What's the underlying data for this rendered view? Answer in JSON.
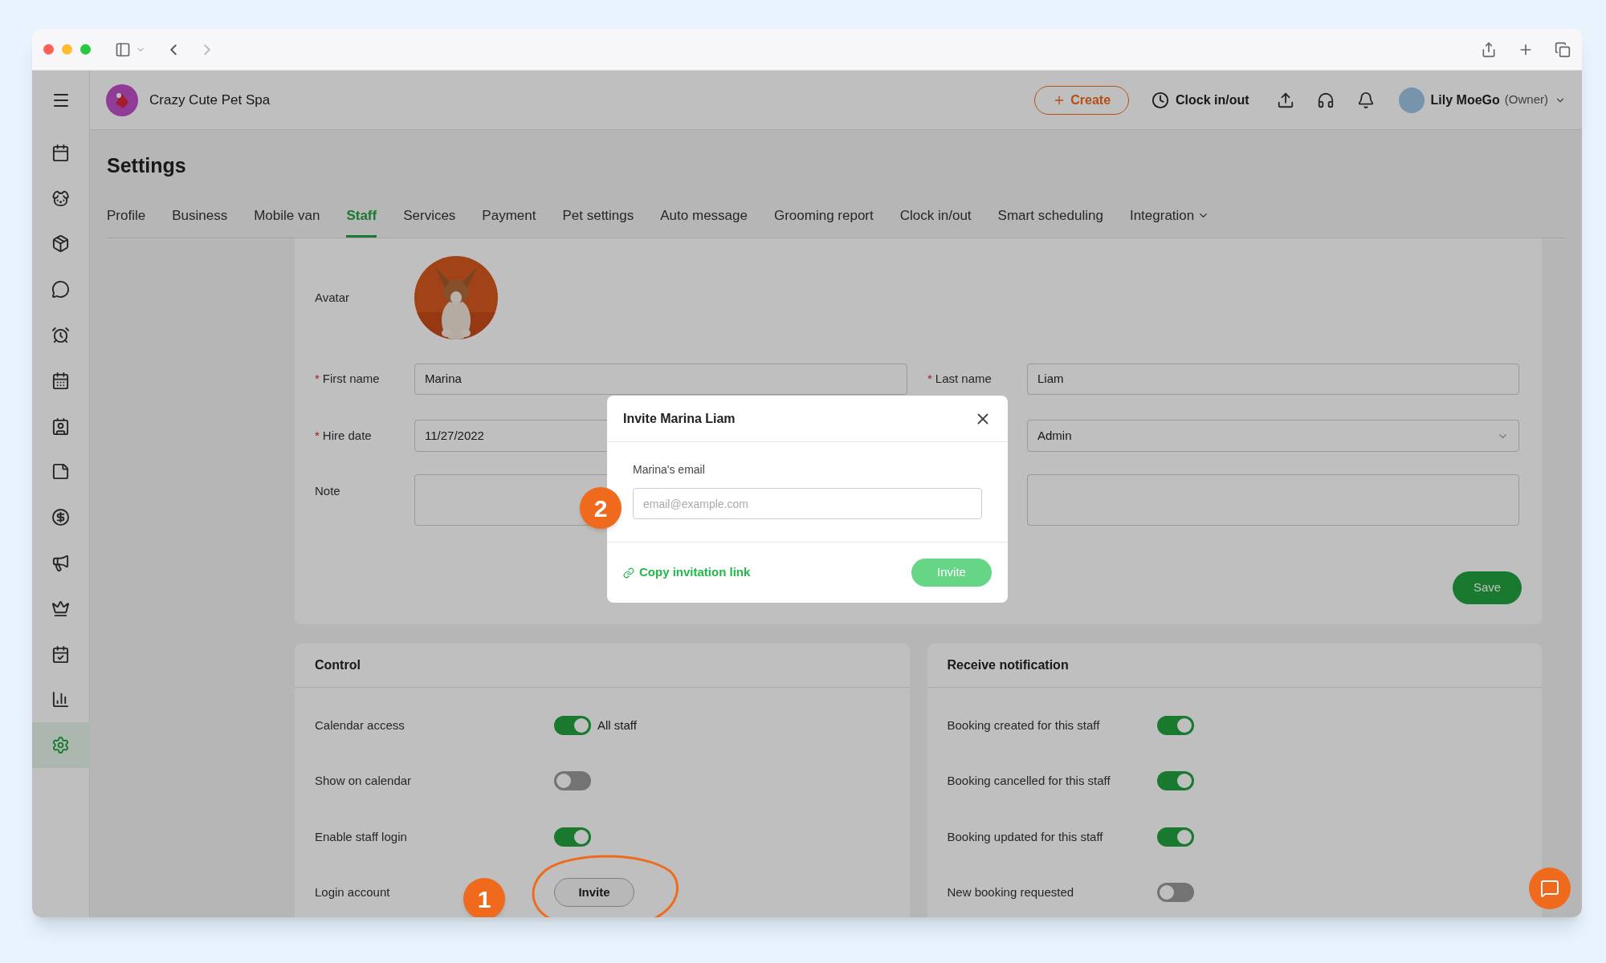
{
  "header": {
    "business": "Crazy Cute Pet Spa",
    "create": "Create",
    "clock": "Clock in/out",
    "user": "Lily MoeGo",
    "role": "(Owner)"
  },
  "sidebar": {
    "items": [
      {
        "selected": false
      },
      {
        "selected": false
      },
      {
        "selected": false
      },
      {
        "selected": false
      },
      {
        "selected": false
      },
      {
        "selected": false
      },
      {
        "selected": false
      },
      {
        "selected": false
      },
      {
        "selected": false
      },
      {
        "selected": false
      },
      {
        "selected": false
      },
      {
        "selected": false
      },
      {
        "selected": false
      },
      {
        "selected": true
      }
    ]
  },
  "page": {
    "title": "Settings"
  },
  "tabs": [
    {
      "label": "Profile",
      "selected": false
    },
    {
      "label": "Business",
      "selected": false
    },
    {
      "label": "Mobile van",
      "selected": false
    },
    {
      "label": "Staff",
      "selected": true
    },
    {
      "label": "Services",
      "selected": false
    },
    {
      "label": "Payment",
      "selected": false
    },
    {
      "label": "Pet settings",
      "selected": false
    },
    {
      "label": "Auto message",
      "selected": false
    },
    {
      "label": "Grooming report",
      "selected": false
    },
    {
      "label": "Clock in/out",
      "selected": false
    },
    {
      "label": "Smart scheduling",
      "selected": false
    },
    {
      "label": "Integration",
      "selected": false,
      "dropdown": true
    }
  ],
  "form": {
    "avatar_label": "Avatar",
    "first_name_mark": "*",
    "first_name_label": "First name",
    "last_name_mark": "*",
    "hire_date_mark": "*",
    "first_name": "Marina",
    "last_name_label": "Last name",
    "last_name": "Liam",
    "hire_date_label": "Hire date",
    "hire_date": "11/27/2022",
    "role": "Admin",
    "note_label": "Note",
    "save": "Save"
  },
  "control": {
    "title": "Control",
    "rows": [
      {
        "kind": "toggle",
        "label": "Calendar access",
        "on": true,
        "caption": "All staff"
      },
      {
        "kind": "toggle",
        "label": "Show on calendar",
        "on": false
      },
      {
        "kind": "toggle",
        "label": "Enable staff login",
        "on": true
      },
      {
        "kind": "button",
        "label": "Login account",
        "button": "Invite"
      }
    ]
  },
  "notifications": {
    "title": "Receive notification",
    "rows": [
      {
        "label": "Booking created for this staff",
        "on": true
      },
      {
        "label": "Booking cancelled for this staff",
        "on": true
      },
      {
        "label": "Booking updated for this staff",
        "on": true
      },
      {
        "label": "New booking requested",
        "on": false
      }
    ]
  },
  "modal": {
    "title": "Invite Marina Liam",
    "email_label": "Marina's email",
    "placeholder": "email@example.com",
    "copy_link": "Copy invitation link",
    "invite": "Invite"
  },
  "annotations": [
    {
      "label": "1"
    },
    {
      "label": "2"
    }
  ]
}
